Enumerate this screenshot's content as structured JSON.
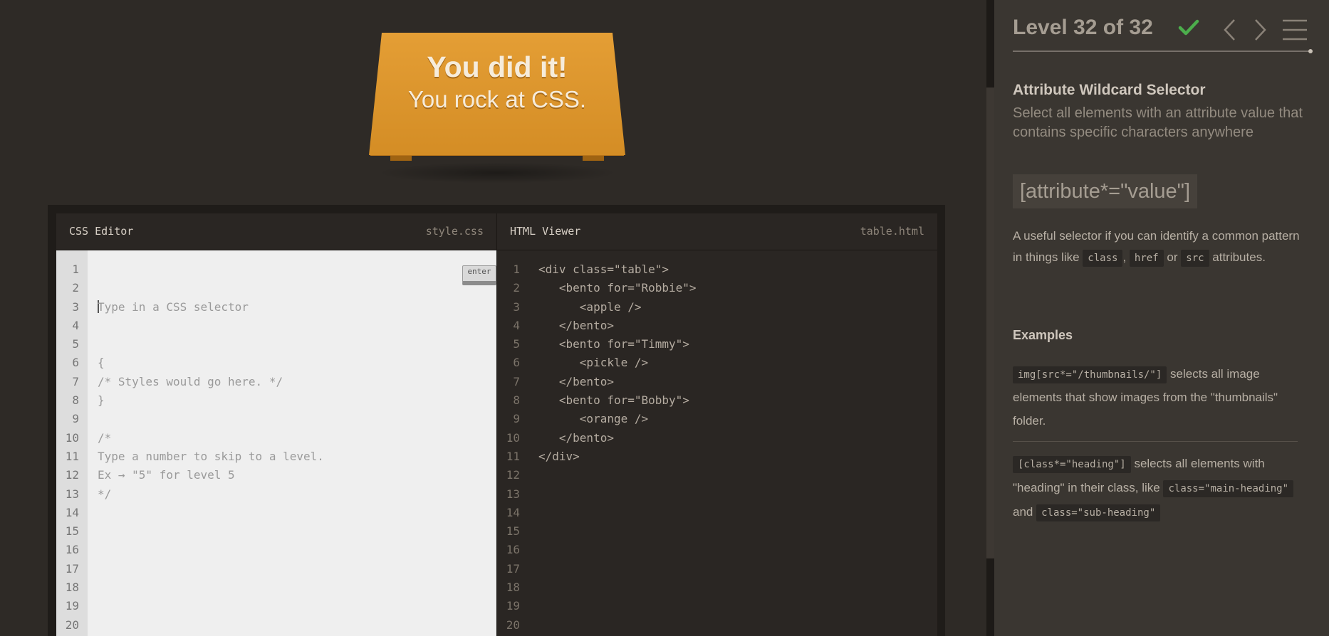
{
  "win": {
    "title": "You did it!",
    "subtitle": "You rock at CSS."
  },
  "css_editor": {
    "title": "CSS Editor",
    "filename": "style.css",
    "enter_label": "enter",
    "input_placeholder": "Type in a CSS selector",
    "line_numbers": [
      "1",
      "2",
      "3",
      "4",
      "5",
      "6",
      "7",
      "8",
      "9",
      "10",
      "11",
      "12",
      "13",
      "14",
      "15",
      "16",
      "17",
      "18",
      "19",
      "20"
    ],
    "lines": [
      "{",
      "/* Styles would go here. */",
      "}",
      "",
      "/*",
      "Type a number to skip to a level.",
      "Ex → \"5\" for level 5",
      "*/"
    ]
  },
  "html_viewer": {
    "title": "HTML Viewer",
    "filename": "table.html",
    "line_numbers": [
      "1",
      "2",
      "3",
      "4",
      "5",
      "6",
      "7",
      "8",
      "9",
      "10",
      "11",
      "12",
      "13",
      "14",
      "15",
      "16",
      "17",
      "18",
      "19",
      "20"
    ],
    "lines": [
      "<div class=\"table\">",
      "   <bento for=\"Robbie\">",
      "      <apple />",
      "   </bento>",
      "   <bento for=\"Timmy\">",
      "      <pickle />",
      "   </bento>",
      "   <bento for=\"Bobby\">",
      "      <orange />",
      "   </bento>",
      "</div>"
    ]
  },
  "sidebar": {
    "level_text": "Level 32 of 32",
    "check_color": "#4cae4c",
    "lesson_title": "Attribute Wildcard Selector",
    "lesson_description": "Select all elements with an attribute value that contains specific characters anywhere",
    "syntax": "[attribute*=\"value\"]",
    "usage": {
      "part1": "A useful selector if you can identify a common pattern in things like",
      "chip1": "class",
      "sep1": ",",
      "chip2": "href",
      "sep2": "or",
      "chip3": "src",
      "part2": "attributes."
    },
    "examples_title": "Examples",
    "example1": {
      "code": "img[src*=\"/thumbnails/\"]",
      "text": "selects all image elements that show images from the \"thumbnails\" folder."
    },
    "example2": {
      "code": "[class*=\"heading\"]",
      "text1": "selects all elements with \"heading\" in their class, like",
      "code2": "class=\"main-heading\"",
      "and": "and",
      "code3": "class=\"sub-heading\""
    }
  }
}
